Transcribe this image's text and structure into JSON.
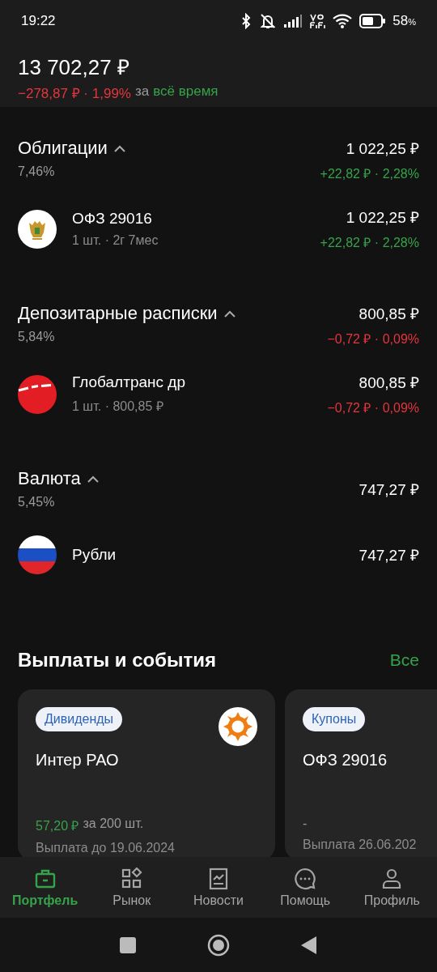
{
  "status_bar": {
    "time": "19:22",
    "battery": "58",
    "battery_unit": "%"
  },
  "summary": {
    "total": "13 702,27 ₽",
    "change": "−278,87 ₽ · 1,99%",
    "color": "#e5353d",
    "period_prefix": "за",
    "period": "всё время"
  },
  "groups": [
    {
      "title": "Облигации",
      "share": "7,46%",
      "value": "1 022,25 ₽",
      "change": "+22,82 ₽ · 2,28%",
      "color": "#37a24a",
      "expanded": true,
      "items": [
        {
          "name": "ОФЗ 29016",
          "detail": "1 шт. · 2г 7мес",
          "value": "1 022,25 ₽",
          "change": "+22,82 ₽ · 2,28%",
          "color": "#37a24a",
          "kind": "emblem"
        }
      ]
    },
    {
      "title": "Депозитарные расписки",
      "share": "5,84%",
      "value": "800,85 ₽",
      "change": "−0,72 ₽ · 0,09%",
      "color": "#e5353d",
      "expanded": true,
      "items": [
        {
          "name": "Глобалтранс др",
          "detail": "1 шт. · 800,85 ₽",
          "value": "800,85 ₽",
          "change": "−0,72 ₽ · 0,09%",
          "color": "#e5353d",
          "kind": "stripe"
        }
      ]
    },
    {
      "title": "Валюта",
      "share": "5,45%",
      "value": "747,27 ₽",
      "expanded": true,
      "items": [
        {
          "name": "Рубли",
          "value": "747,27 ₽",
          "kind": "flag"
        }
      ]
    }
  ],
  "events": {
    "title": "Выплаты и события",
    "link": "Все",
    "cards": [
      {
        "tag": "Дивиденды",
        "name": "Интер РАО",
        "amount": "57,20 ₽",
        "amount_suffix": "за 200 шт.",
        "date": "Выплата до 19.06.2024"
      },
      {
        "tag": "Купоны",
        "name": "ОФЗ 29016",
        "amount_suffix": "-",
        "date": "Выплата 26.06.202"
      }
    ]
  },
  "nav": [
    {
      "label": "Портфель",
      "selected": true
    },
    {
      "label": "Рынок",
      "selected": false
    },
    {
      "label": "Новости",
      "selected": false
    },
    {
      "label": "Помощь",
      "selected": false
    },
    {
      "label": "Профиль",
      "selected": false
    }
  ]
}
